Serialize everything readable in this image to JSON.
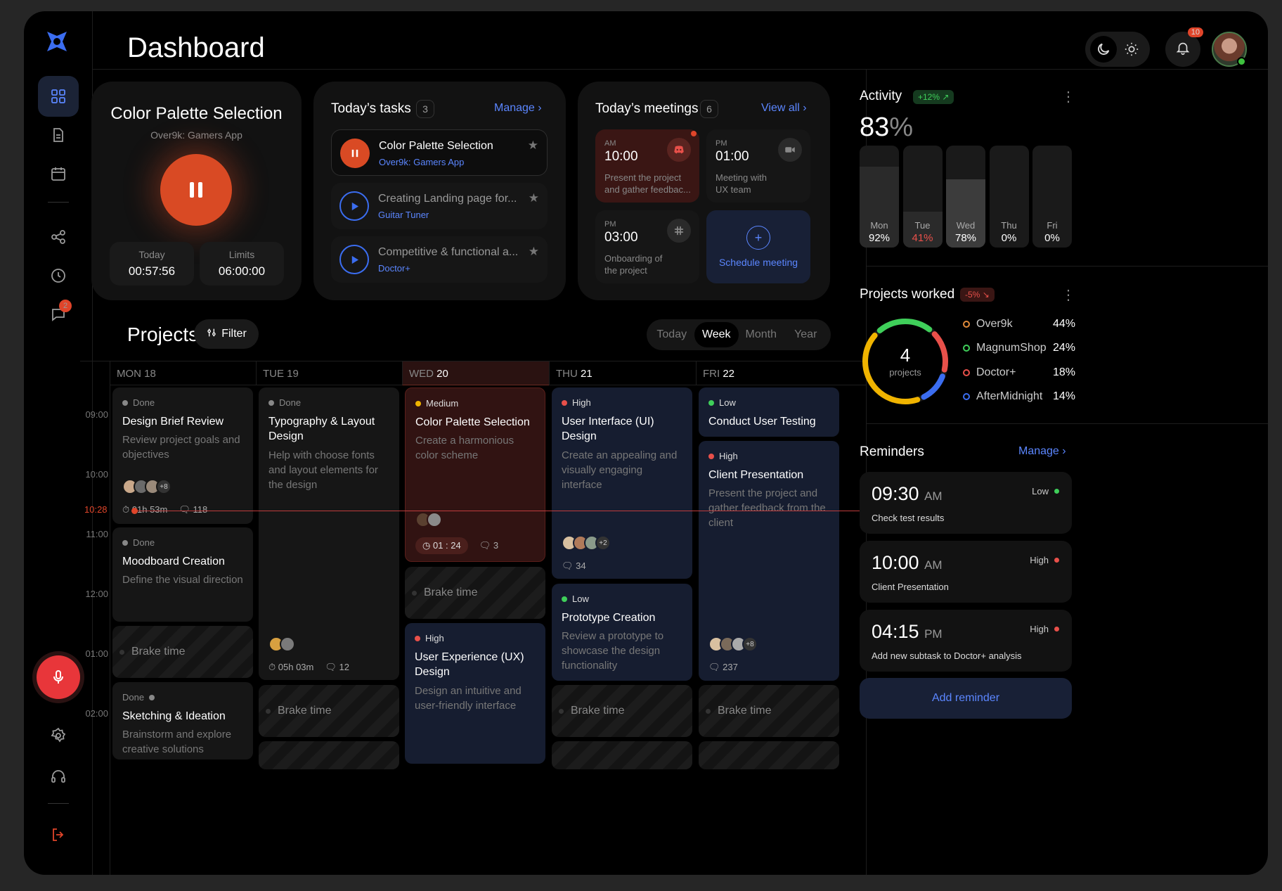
{
  "header": {
    "title": "Dashboard",
    "notifications": "10"
  },
  "sidebar": {
    "messages_badge": "2"
  },
  "focus_card": {
    "title": "Color Palette Selection",
    "subtitle": "Over9k: Gamers App",
    "today_label": "Today",
    "today_value": "00:57:56",
    "limits_label": "Limits",
    "limits_value": "06:00:00"
  },
  "tasks": {
    "title": "Today’s tasks",
    "count": "3",
    "manage": "Manage",
    "items": [
      {
        "name": "Color Palette Selection",
        "project": "Over9k: Gamers App"
      },
      {
        "name": "Creating Landing page for...",
        "project": "Guitar Tuner"
      },
      {
        "name": "Competitive & functional a...",
        "project": "Doctor+"
      }
    ]
  },
  "meetings": {
    "title": "Today’s meetings",
    "count": "6",
    "view_all": "View all",
    "items": [
      {
        "ampm": "AM",
        "time": "10:00",
        "desc": "Present the project and gather feedbac...",
        "icon": "discord-icon"
      },
      {
        "ampm": "PM",
        "time": "01:00",
        "desc": "Meeting with UX team",
        "icon": "video-icon"
      },
      {
        "ampm": "PM",
        "time": "03:00",
        "desc": "Onboarding of the project",
        "icon": "slack-icon"
      }
    ],
    "schedule": "Schedule meeting"
  },
  "projects": {
    "title": "Projects",
    "filter": "Filter",
    "ranges": [
      "Today",
      "Week",
      "Month",
      "Year"
    ],
    "active_range": "Week",
    "days": [
      {
        "dow": "MON",
        "date": "18"
      },
      {
        "dow": "TUE",
        "date": "19"
      },
      {
        "dow": "WED",
        "date": "20"
      },
      {
        "dow": "THU",
        "date": "21"
      },
      {
        "dow": "FRI",
        "date": "22"
      }
    ],
    "times": [
      "09:00",
      "10:00",
      "11:00",
      "12:00",
      "01:00",
      "02:00"
    ],
    "now": "10:28",
    "brake": "Brake time",
    "events": {
      "mon1": {
        "status": "Done",
        "title": "Design Brief Review",
        "desc": "Review project goals and objectives",
        "more": "+8",
        "time": "01h 53m",
        "comments": "118"
      },
      "mon2": {
        "status": "Done",
        "title": "Moodboard Creation",
        "desc": "Define the visual direction"
      },
      "mon3": {
        "status": "Done",
        "title": "Sketching & Ideation",
        "desc": "Brainstorm and explore creative solutions"
      },
      "tue1": {
        "status": "Done",
        "title": "Typography & Layout Design",
        "desc": "Help with choose fonts and layout elements for the design",
        "time": "05h 03m",
        "comments": "12"
      },
      "wed1": {
        "status": "Medium",
        "title": "Color Palette Selection",
        "desc": "Create a harmonious color scheme",
        "time": "01 : 24",
        "comments": "3"
      },
      "wed2": {
        "status": "High",
        "title": "User Experience (UX) Design",
        "desc": "Design an intuitive and user-friendly interface"
      },
      "thu1": {
        "status": "High",
        "title": "User Interface (UI) Design",
        "desc": "Create an appealing and visually engaging interface",
        "more": "+2",
        "comments": "34"
      },
      "thu2": {
        "status": "Low",
        "title": "Prototype Creation",
        "desc": "Review a prototype to showcase the design functionality"
      },
      "fri1": {
        "status": "Low",
        "title": "Conduct User Testing"
      },
      "fri2": {
        "status": "High",
        "title": "Client Presentation",
        "desc": "Present the project and gather feedback from the client",
        "more": "+8",
        "comments": "237"
      }
    }
  },
  "activity": {
    "title": "Activity",
    "change": "+12%",
    "value": "83",
    "unit": "%",
    "bars": [
      {
        "day": "Mon",
        "pct": "92%",
        "value": 0.92
      },
      {
        "day": "Tue",
        "pct": "41%",
        "value": 0.41
      },
      {
        "day": "Wed",
        "pct": "78%",
        "value": 0.78
      },
      {
        "day": "Thu",
        "pct": "0%",
        "value": 0
      },
      {
        "day": "Fri",
        "pct": "0%",
        "value": 0
      }
    ]
  },
  "projects_worked": {
    "title": "Projects worked",
    "change": "-5%",
    "total": "4",
    "total_label": "projects",
    "items": [
      {
        "name": "Over9k",
        "pct": "44%",
        "color": "#e08a3a"
      },
      {
        "name": "MagnumShop",
        "pct": "24%",
        "color": "#3fcf5a"
      },
      {
        "name": "Doctor+",
        "pct": "18%",
        "color": "#e8504a"
      },
      {
        "name": "AfterMidnight",
        "pct": "14%",
        "color": "#3b6df0"
      }
    ]
  },
  "reminders": {
    "title": "Reminders",
    "manage": "Manage",
    "items": [
      {
        "time": "09:30",
        "ampm": "AM",
        "note": "Check test results",
        "priority": "Low"
      },
      {
        "time": "10:00",
        "ampm": "AM",
        "note": "Client Presentation",
        "priority": "High"
      },
      {
        "time": "04:15",
        "ampm": "PM",
        "note": "Add new subtask  to Doctor+ analysis",
        "priority": "High"
      }
    ],
    "add": "Add reminder"
  },
  "colors": {
    "accent": "#5b86ff",
    "orange": "#d94a24",
    "red": "#e8504a",
    "green": "#3fcf5a",
    "yellow": "#f0b400"
  }
}
